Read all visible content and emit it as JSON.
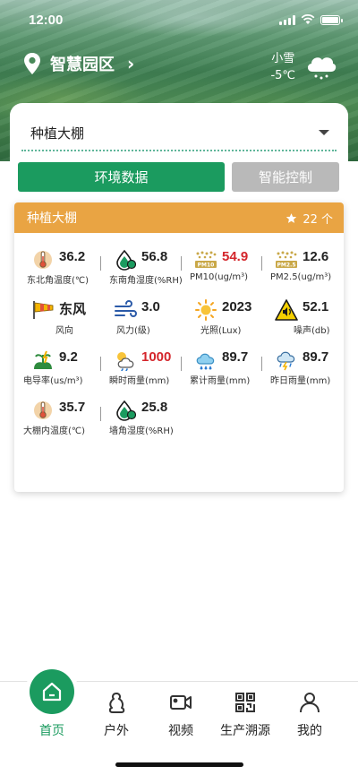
{
  "status": {
    "time": "12:00"
  },
  "header": {
    "location": "智慧园区",
    "weather": {
      "condition": "小雪",
      "temp": "-5℃",
      "icon": "snow-cloud-icon"
    }
  },
  "select": {
    "value": "种植大棚"
  },
  "tabs": [
    {
      "label": "环境数据",
      "active": true
    },
    {
      "label": "智能控制",
      "active": false
    }
  ],
  "card": {
    "title": "种植大棚",
    "count": "22 个",
    "metrics": [
      {
        "value": "36.2",
        "label": "东北角温度(℃)",
        "icon": "thermometer-icon"
      },
      {
        "value": "56.8",
        "label": "东南角湿度(%RH)",
        "icon": "humidity-drop-icon"
      },
      {
        "value": "54.9",
        "label": "PM10(ug/m³)",
        "icon": "pm10-icon",
        "alert": true
      },
      {
        "value": "12.6",
        "label": "PM2.5(ug/m³)",
        "icon": "pm25-icon"
      },
      {
        "value": "东风",
        "label": "风向",
        "icon": "windsock-icon"
      },
      {
        "value": "3.0",
        "label": "风力(级)",
        "icon": "wind-icon"
      },
      {
        "value": "2023",
        "label": "光照(Lux)",
        "icon": "sun-icon"
      },
      {
        "value": "52.1",
        "label": "噪声(db)",
        "icon": "noise-warning-icon"
      },
      {
        "value": "9.2",
        "label": "电导率(us/m³)",
        "icon": "conductivity-icon"
      },
      {
        "value": "1000",
        "label": "瞬时雨量(mm)",
        "icon": "sun-rain-icon",
        "alert": true
      },
      {
        "value": "89.7",
        "label": "累计雨量(mm)",
        "icon": "rain-cloud-icon"
      },
      {
        "value": "89.7",
        "label": "昨日雨量(mm)",
        "icon": "storm-cloud-icon"
      },
      {
        "value": "35.7",
        "label": "大棚内温度(℃)",
        "icon": "thermometer-icon"
      },
      {
        "value": "25.8",
        "label": "墙角湿度(%RH)",
        "icon": "humidity-drop-icon"
      }
    ]
  },
  "nav": [
    {
      "label": "首页",
      "icon": "home-icon",
      "active": true
    },
    {
      "label": "户外",
      "icon": "outdoor-icon"
    },
    {
      "label": "视频",
      "icon": "video-icon"
    },
    {
      "label": "生产溯源",
      "icon": "qr-code-icon"
    },
    {
      "label": "我的",
      "icon": "user-icon"
    }
  ],
  "colors": {
    "primary": "#1b9b5f",
    "accent": "#e9a443",
    "alert": "#d4262c",
    "inactive": "#b9b9b9"
  }
}
